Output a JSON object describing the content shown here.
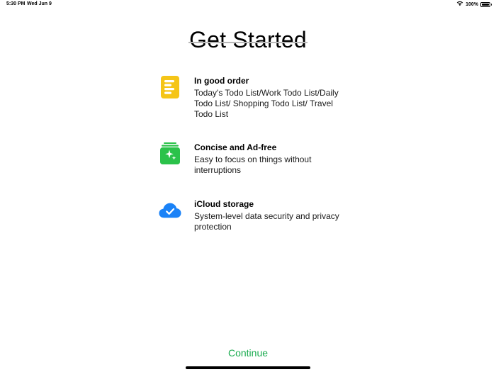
{
  "status_bar": {
    "time": "5:30 PM",
    "date": "Wed Jun 9",
    "battery_text": "100%",
    "battery_level": 1.0
  },
  "title": "Get Started",
  "features": [
    {
      "icon": "list-doc-icon",
      "icon_color": "#f5c518",
      "title": "In good order",
      "description": "Today's Todo List/Work Todo List/Daily Todo List/ Shopping Todo List/ Travel Todo List"
    },
    {
      "icon": "sparkle-stack-icon",
      "icon_color": "#2bc24a",
      "title": "Concise and Ad-free",
      "description": "Easy to focus on things without interruptions"
    },
    {
      "icon": "icloud-check-icon",
      "icon_color": "#1a82f7",
      "title": "iCloud storage",
      "description": "System-level data security and privacy protection"
    }
  ],
  "continue_label": "Continue",
  "colors": {
    "accent": "#1aab4f"
  }
}
